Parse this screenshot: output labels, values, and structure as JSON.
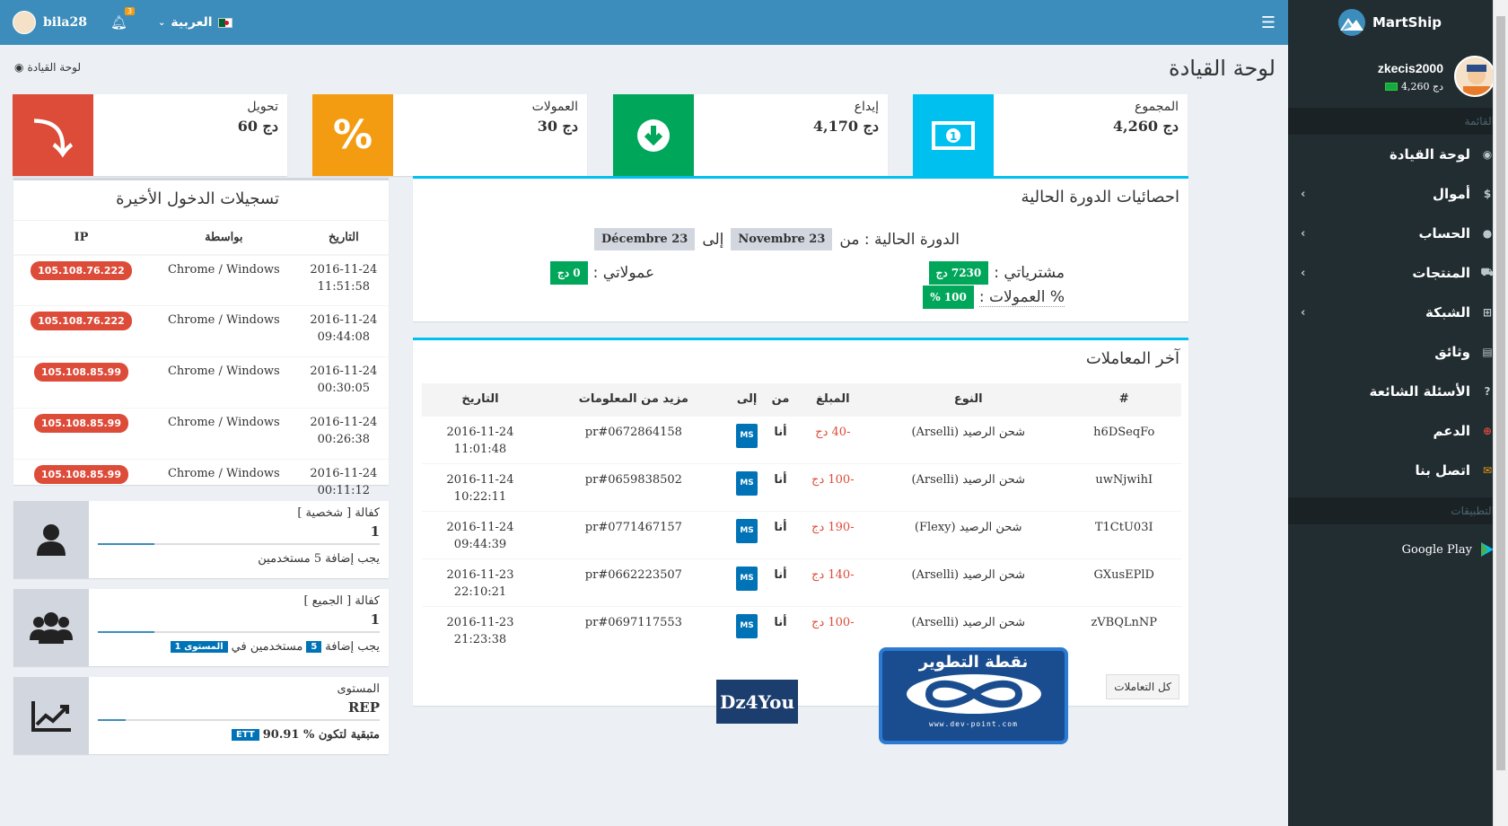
{
  "topbar": {
    "username": "bila28",
    "notifications_count": "3",
    "language": "العربية",
    "menu_icon": "hamburger-icon"
  },
  "sidebar": {
    "brand": "MartShip",
    "user": {
      "name": "zkecis2000",
      "balance": "4,260 دج"
    },
    "header_menu": "القائمة",
    "items": [
      {
        "label": "لوحة القيادة",
        "icon": "dashboard-icon",
        "has_chevron": false
      },
      {
        "label": "أموال",
        "icon": "dollar-icon",
        "has_chevron": true
      },
      {
        "label": "الحساب",
        "icon": "user-icon",
        "has_chevron": true
      },
      {
        "label": "المنتجات",
        "icon": "cart-icon",
        "has_chevron": true
      },
      {
        "label": "الشبكة",
        "icon": "sitemap-icon",
        "has_chevron": true
      },
      {
        "label": "وثائق",
        "icon": "id-card-icon",
        "has_chevron": false
      },
      {
        "label": "الأسئلة الشائعة",
        "icon": "question-icon",
        "has_chevron": false
      },
      {
        "label": "الدعم",
        "icon": "lifebuoy-icon",
        "has_chevron": false
      },
      {
        "label": "اتصل بنا",
        "icon": "envelope-icon",
        "has_chevron": false
      }
    ],
    "header_apps": "التطبيقات",
    "google_play": "Google Play"
  },
  "page": {
    "title": "لوحة القيادة",
    "breadcrumb": "لوحة القيادة"
  },
  "info_boxes": [
    {
      "label": "المجموع",
      "value": "4,260 دج",
      "color": "#00c0ef",
      "icon": "money-icon"
    },
    {
      "label": "إيداع",
      "value": "4,170 دج",
      "color": "#00a65a",
      "icon": "arrow-down-circle-icon"
    },
    {
      "label": "العمولات",
      "value": "30 دج",
      "color": "#f39c12",
      "icon": "percent-icon"
    },
    {
      "label": "تحويل",
      "value": "60 دج",
      "color": "#dd4b39",
      "icon": "transfer-arrow-icon"
    }
  ],
  "logins": {
    "title": "تسجيلات الدخول الأخيرة",
    "columns": [
      "التاريخ",
      "بواسطة",
      "IP"
    ],
    "rows": [
      {
        "date": "2016-11-24",
        "time": "11:51:58",
        "via": "Chrome / Windows",
        "ip": "105.108.76.222"
      },
      {
        "date": "2016-11-24",
        "time": "09:44:08",
        "via": "Chrome / Windows",
        "ip": "105.108.76.222"
      },
      {
        "date": "2016-11-24",
        "time": "00:30:05",
        "via": "Chrome / Windows",
        "ip": "105.108.85.99"
      },
      {
        "date": "2016-11-24",
        "time": "00:26:38",
        "via": "Chrome / Windows",
        "ip": "105.108.85.99"
      },
      {
        "date": "2016-11-24",
        "time": "00:11:12",
        "via": "Chrome / Windows",
        "ip": "105.108.85.99"
      }
    ]
  },
  "guarantees": [
    {
      "title": "كفالة [ شخصية ]",
      "value": "1",
      "foot": "يجب إضافة 5 مستخدمين",
      "icon": "user-icon",
      "progress": 0.2
    },
    {
      "title": "كفالة [ الجميع ]",
      "value": "1",
      "foot_prefix": "يجب إضافة",
      "foot_num": "5",
      "foot_mid": "مستخدمين في",
      "foot_tag": "المستوى 1",
      "icon": "users-icon",
      "progress": 0.2
    },
    {
      "title": "المستوى",
      "value": "REP",
      "foot_text": "90.91 % متبقية لتكون",
      "foot_tag": "ETT",
      "icon": "line-chart-icon",
      "progress": 0.1
    }
  ],
  "period": {
    "title": "احصائيات الدورة الحالية",
    "label": "الدورة الحالية : من",
    "from": "23 Novembre",
    "to_label": "إلى",
    "to": "23 Décembre",
    "purchases_label": "مشترياتي :",
    "purchases_value": "7230 دج",
    "commissions_pct_label": "% العمولات :",
    "commissions_pct_value": "100 %",
    "my_commissions_label": "عمولاتي :",
    "my_commissions_value": "0 دج"
  },
  "transactions": {
    "title": "آخر المعاملات",
    "columns": [
      "#",
      "النوع",
      "المبلغ",
      "من",
      "إلى",
      "مزيد من المعلومات",
      "التاريخ"
    ],
    "rows": [
      {
        "id": "h6DSeqFo",
        "type": "شحن الرصيد (Arselli)",
        "amount": "-40 دج",
        "from": "أنا",
        "to": "MS",
        "info": "pr#0672864158",
        "date": "2016-11-24",
        "time": "11:01:48"
      },
      {
        "id": "uwNjwihI",
        "type": "شحن الرصيد (Arselli)",
        "amount": "-100 دج",
        "from": "أنا",
        "to": "MS",
        "info": "pr#0659838502",
        "date": "2016-11-24",
        "time": "10:22:11"
      },
      {
        "id": "T1CtU03I",
        "type": "شحن الرصيد (Flexy)",
        "amount": "-190 دج",
        "from": "أنا",
        "to": "MS",
        "info": "pr#0771467157",
        "date": "2016-11-24",
        "time": "09:44:39"
      },
      {
        "id": "GXusEPlD",
        "type": "شحن الرصيد (Arselli)",
        "amount": "-140 دج",
        "from": "أنا",
        "to": "MS",
        "info": "pr#0662223507",
        "date": "2016-11-23",
        "time": "22:10:21"
      },
      {
        "id": "zVBQLnNP",
        "type": "شحن الرصيد (Arselli)",
        "amount": "-100 دج",
        "from": "أنا",
        "to": "MS",
        "info": "pr#0697117553",
        "date": "2016-11-23",
        "time": "21:23:38"
      }
    ],
    "all_button": "كل التعاملات"
  },
  "watermarks": {
    "dz4you": "Dz4You",
    "devpoint": "نقطة التطوير",
    "devpoint_url": "www.dev-point.com"
  }
}
